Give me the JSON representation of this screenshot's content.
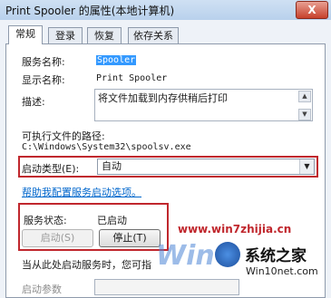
{
  "window": {
    "title": "Print Spooler 的属性(本地计算机)",
    "close_label": "X"
  },
  "tabs": [
    {
      "label": "常规",
      "active": true
    },
    {
      "label": "登录",
      "active": false
    },
    {
      "label": "恢复",
      "active": false
    },
    {
      "label": "依存关系",
      "active": false
    }
  ],
  "general": {
    "service_name_label": "服务名称:",
    "service_name_value": "Spooler",
    "display_name_label": "显示名称:",
    "display_name_value": "Print Spooler",
    "description_label": "描述:",
    "description_value": "将文件加载到内存供稍后打印",
    "exe_path_label": "可执行文件的路径:",
    "exe_path_value": "C:\\Windows\\System32\\spoolsv.exe",
    "startup_type_label": "启动类型(E):",
    "startup_type_value": "自动",
    "help_link": "帮助我配置服务启动选项。",
    "service_status_label": "服务状态:",
    "service_status_value": "已启动",
    "start_button": "启动(S)",
    "stop_button": "停止(T)",
    "start_hint": "当从此处启动服务时，您可指",
    "start_params_label": "启动参数"
  },
  "watermark": {
    "url": "www.win7zhijia.cn",
    "brand": "系统之家",
    "site": "Win10net.com",
    "logo_text": "Win"
  },
  "colors": {
    "highlight_border": "#c0272d",
    "selection": "#3399ff",
    "link": "#0066cc"
  }
}
